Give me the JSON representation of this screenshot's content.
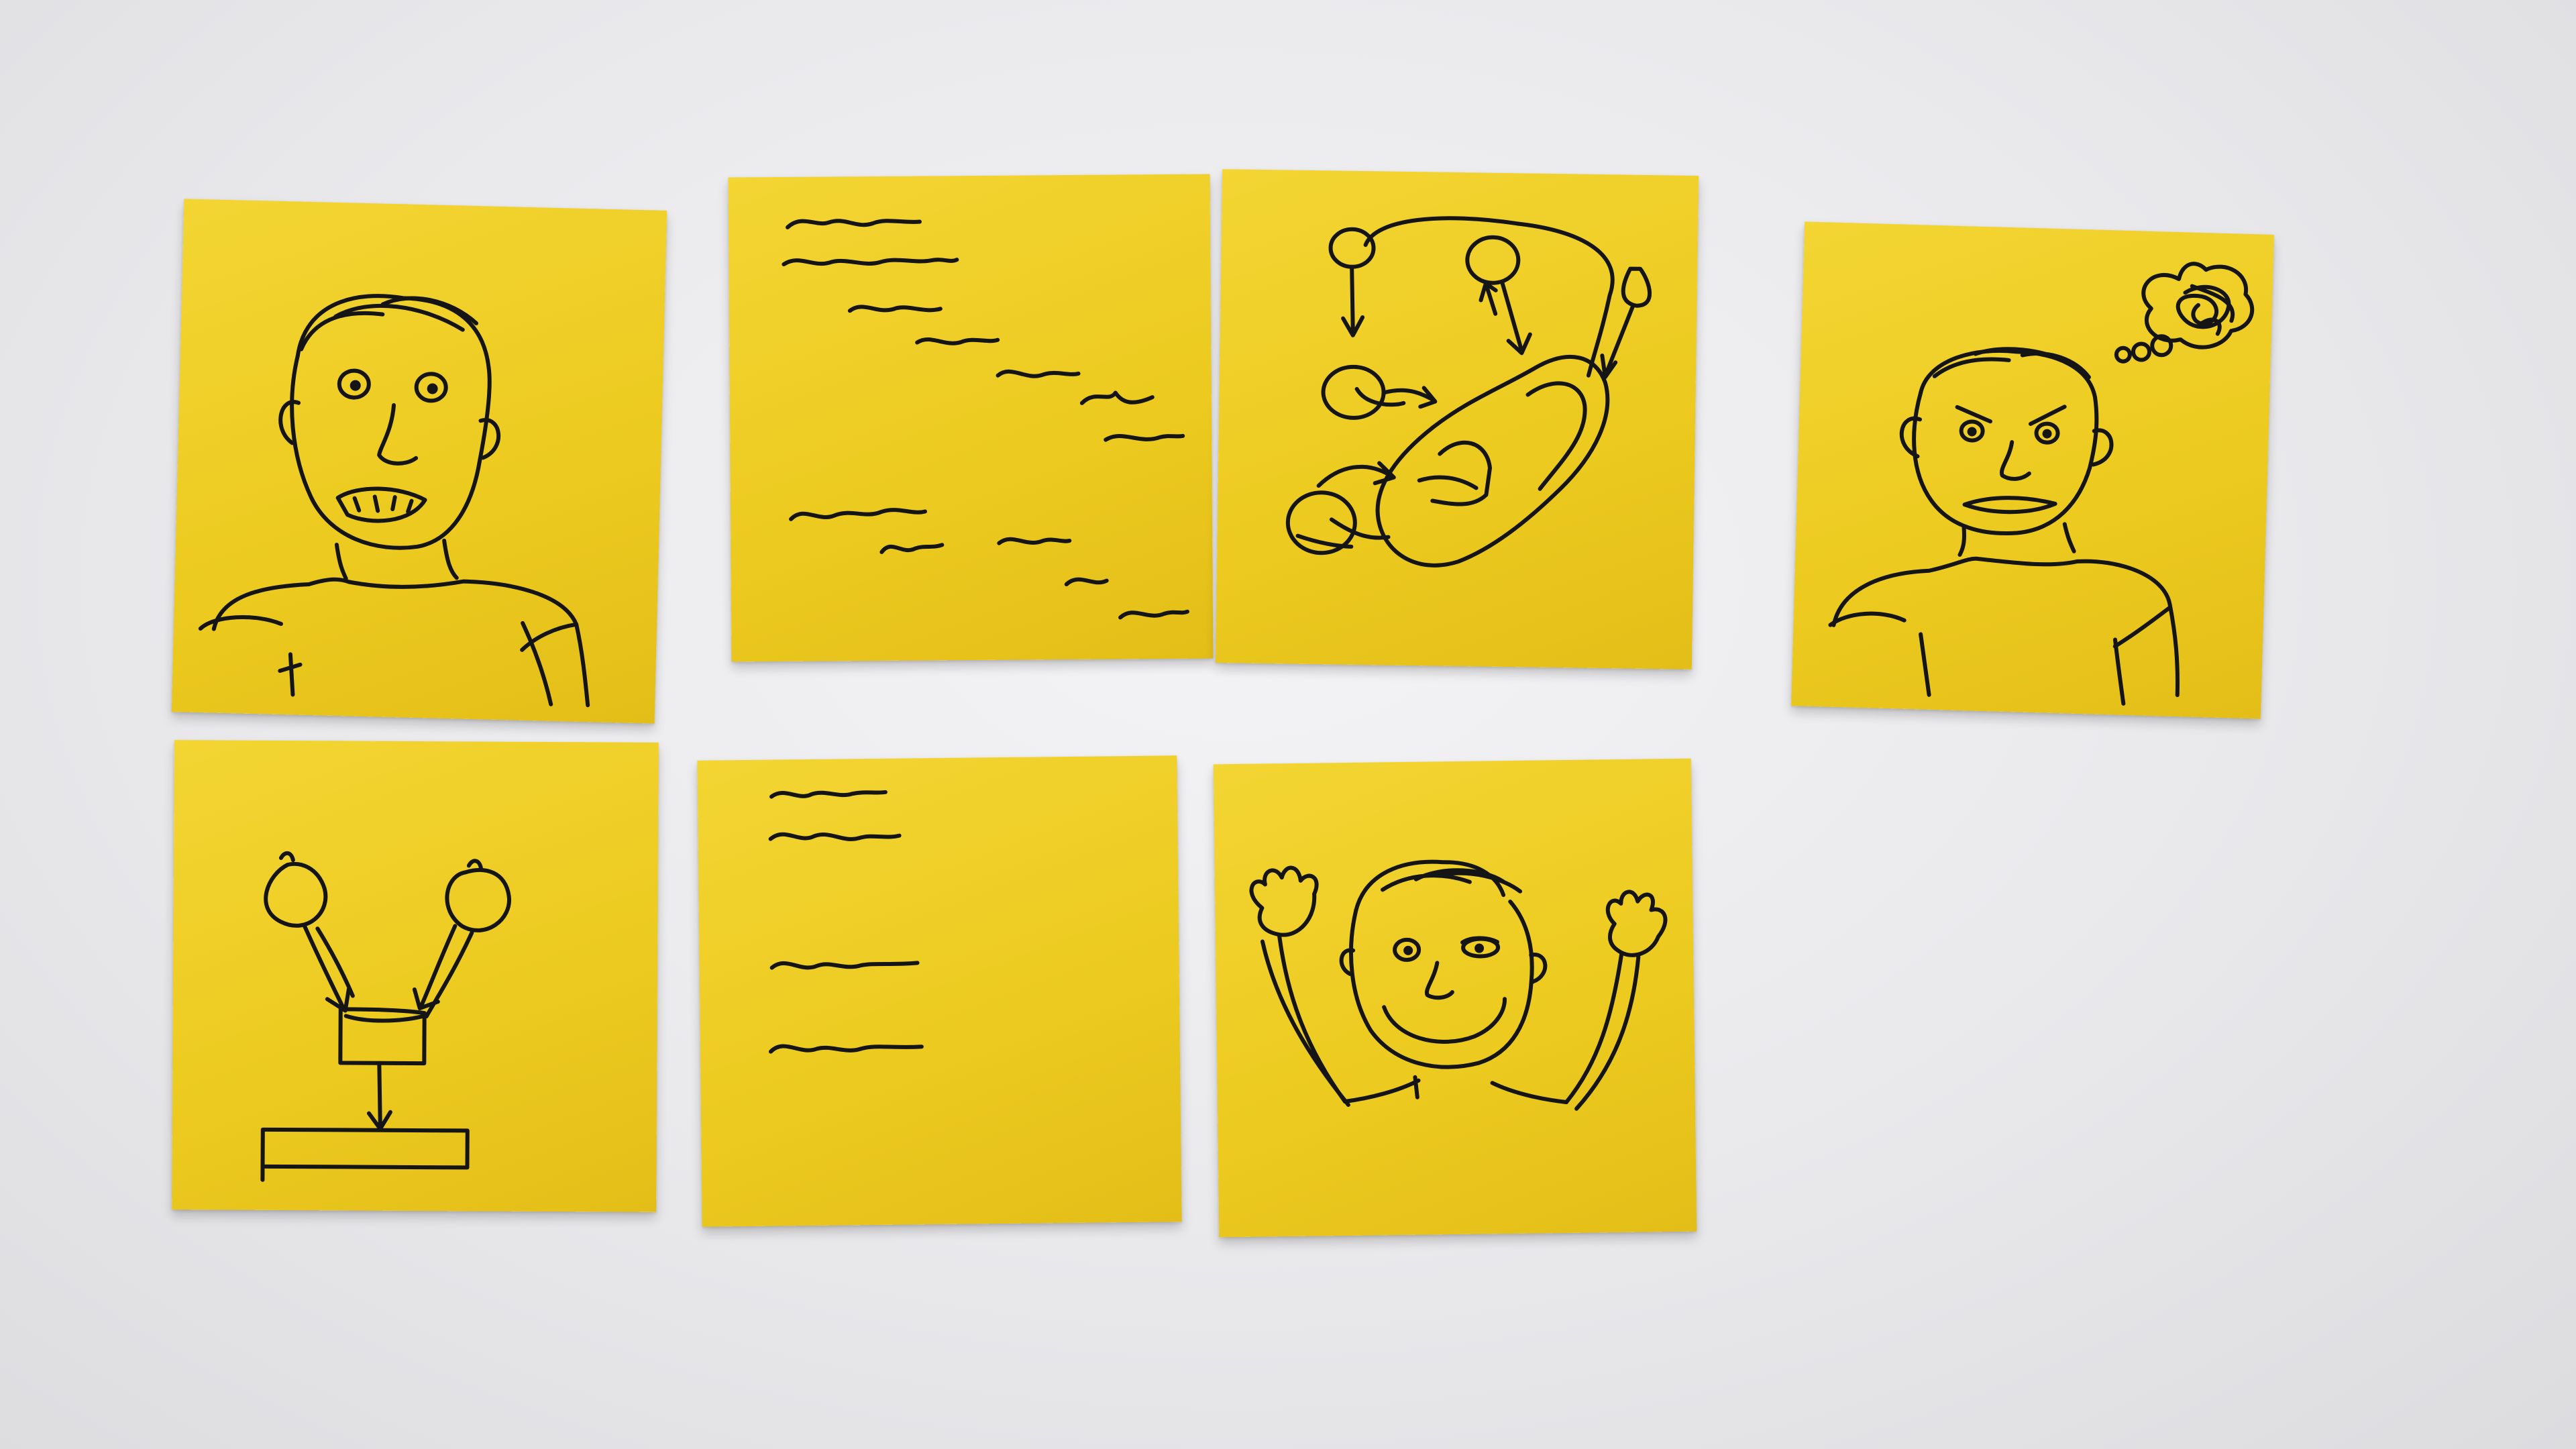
{
  "scene": {
    "background": "white surface",
    "note_color": "#ecca1f",
    "ink_color": "#151515"
  },
  "notes": [
    {
      "id": 1,
      "drawing": "person-talking-face-icon"
    },
    {
      "id": 2,
      "drawing": "scribbled-text-lines-icon"
    },
    {
      "id": 3,
      "drawing": "thoughts-into-mind-diagram-icon"
    },
    {
      "id": 4,
      "drawing": "angry-person-thought-cloud-icon"
    },
    {
      "id": 5,
      "drawing": "merging-thoughts-diagram-icon"
    },
    {
      "id": 6,
      "drawing": "short-text-lines-icon"
    },
    {
      "id": 7,
      "drawing": "happy-person-hands-up-icon"
    }
  ]
}
